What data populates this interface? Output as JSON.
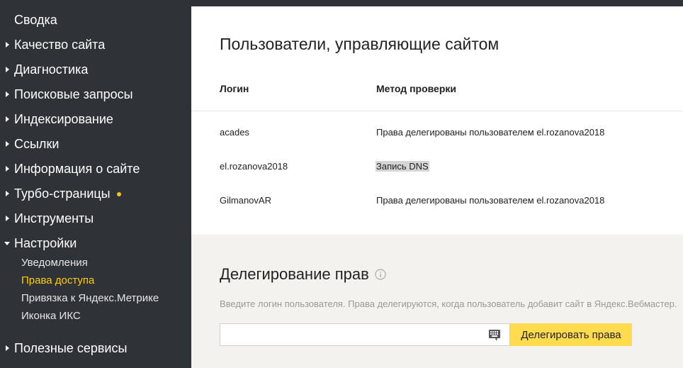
{
  "sidebar": {
    "items": [
      {
        "label": "Сводка",
        "arrow": "none"
      },
      {
        "label": "Качество сайта",
        "arrow": "right"
      },
      {
        "label": "Диагностика",
        "arrow": "right"
      },
      {
        "label": "Поисковые запросы",
        "arrow": "right"
      },
      {
        "label": "Индексирование",
        "arrow": "right"
      },
      {
        "label": "Ссылки",
        "arrow": "right"
      },
      {
        "label": "Информация о сайте",
        "arrow": "right"
      },
      {
        "label": "Турбо-страницы",
        "arrow": "right",
        "badge": "dot"
      },
      {
        "label": "Инструменты",
        "arrow": "right"
      },
      {
        "label": "Настройки",
        "arrow": "down"
      },
      {
        "label": "Полезные сервисы",
        "arrow": "right"
      }
    ],
    "settings_sub": [
      {
        "label": "Уведомления",
        "active": false
      },
      {
        "label": "Права доступа",
        "active": true
      },
      {
        "label": "Привязка к Яндекс.Метрике",
        "active": false
      },
      {
        "label": "Иконка ИКС",
        "active": false
      }
    ]
  },
  "users": {
    "title": "Пользователи, управляющие сайтом",
    "columns": [
      "Логин",
      "Метод проверки"
    ],
    "rows": [
      {
        "login": "acades",
        "method": "Права делегированы пользователем el.rozanova2018"
      },
      {
        "login": "el.rozanova2018",
        "method": "Запись DNS"
      },
      {
        "login": "GilmanovAR",
        "method": "Права делегированы пользователем el.rozanova2018"
      }
    ]
  },
  "delegation": {
    "title": "Делегирование прав",
    "hint": "Введите логин пользователя. Права делегируются, когда пользователь добавит сайт в Яндекс.Вебмастер.",
    "input_value": "",
    "button_label": "Делегировать права"
  },
  "colors": {
    "sidebar_bg": "#2f3337",
    "accent_yellow": "#ffdb4d",
    "active_link": "#ffcc00",
    "bottom_bg": "#f3f2ee"
  }
}
